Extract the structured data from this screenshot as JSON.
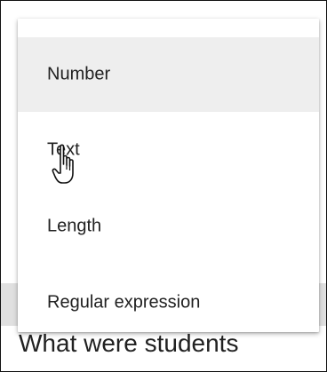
{
  "menu": {
    "items": [
      {
        "label": "Number",
        "highlighted": true
      },
      {
        "label": "Text",
        "highlighted": false
      },
      {
        "label": "Length",
        "highlighted": false
      },
      {
        "label": "Regular expression",
        "highlighted": false
      }
    ]
  },
  "background": {
    "partial_text": "What were students"
  },
  "cursor": {
    "icon": "hand-pointer-icon"
  }
}
